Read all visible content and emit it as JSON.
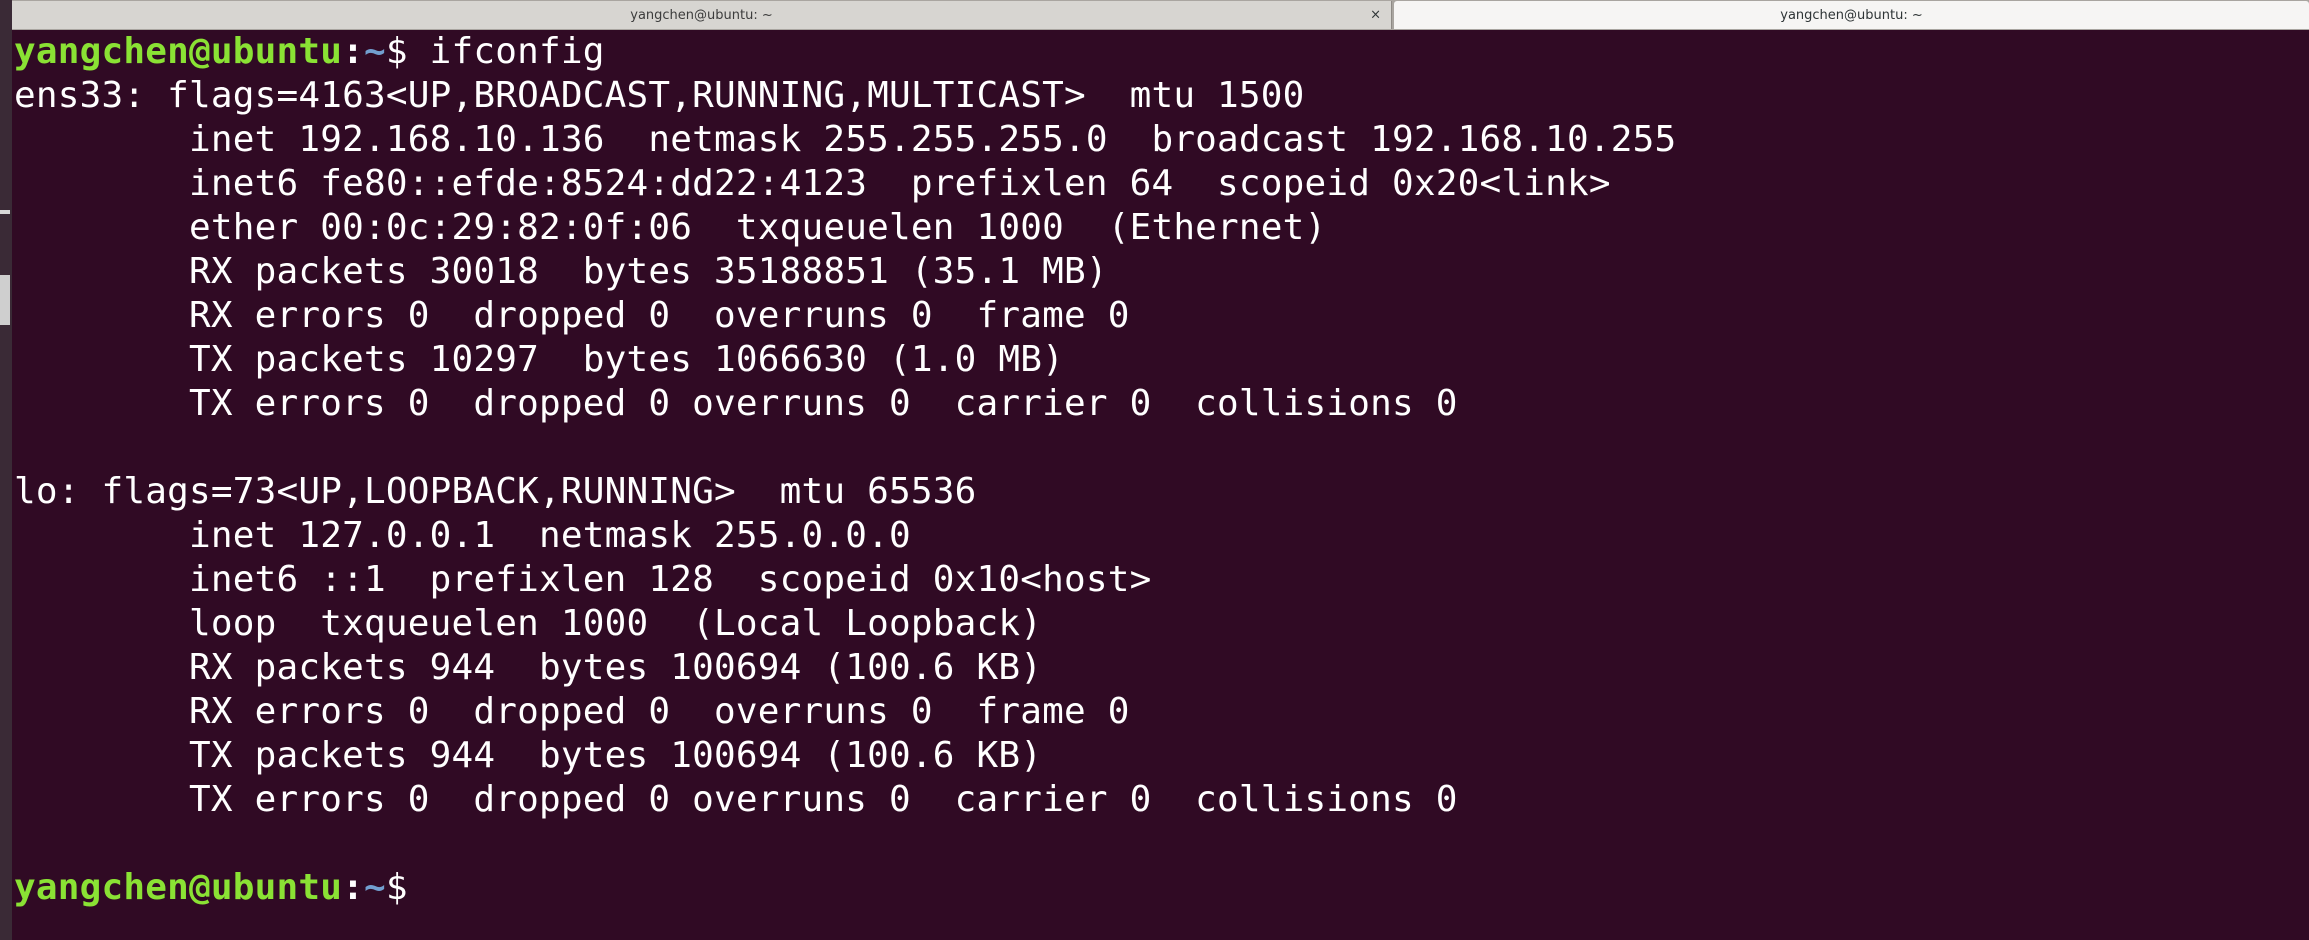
{
  "tabs": [
    {
      "title": "yangchen@ubuntu: ~",
      "active": false,
      "close_glyph": "×"
    },
    {
      "title": "yangchen@ubuntu: ~",
      "active": true
    }
  ],
  "prompt": {
    "user_host": "yangchen@ubuntu",
    "separator": ":",
    "path": "~",
    "symbol": "$ "
  },
  "command": "ifconfig",
  "output": [
    "ens33: flags=4163<UP,BROADCAST,RUNNING,MULTICAST>  mtu 1500",
    "        inet 192.168.10.136  netmask 255.255.255.0  broadcast 192.168.10.255",
    "        inet6 fe80::efde:8524:dd22:4123  prefixlen 64  scopeid 0x20<link>",
    "        ether 00:0c:29:82:0f:06  txqueuelen 1000  (Ethernet)",
    "        RX packets 30018  bytes 35188851 (35.1 MB)",
    "        RX errors 0  dropped 0  overruns 0  frame 0",
    "        TX packets 10297  bytes 1066630 (1.0 MB)",
    "        TX errors 0  dropped 0 overruns 0  carrier 0  collisions 0",
    "",
    "lo: flags=73<UP,LOOPBACK,RUNNING>  mtu 65536",
    "        inet 127.0.0.1  netmask 255.0.0.0",
    "        inet6 ::1  prefixlen 128  scopeid 0x10<host>",
    "        loop  txqueuelen 1000  (Local Loopback)",
    "        RX packets 944  bytes 100694 (100.6 KB)",
    "        RX errors 0  dropped 0  overruns 0  frame 0",
    "        TX packets 944  bytes 100694 (100.6 KB)",
    "        TX errors 0  dropped 0 overruns 0  carrier 0  collisions 0",
    ""
  ],
  "colors": {
    "background": "#300a24",
    "user_host": "#8ae234",
    "path": "#729fcf",
    "text": "#ffffff"
  }
}
